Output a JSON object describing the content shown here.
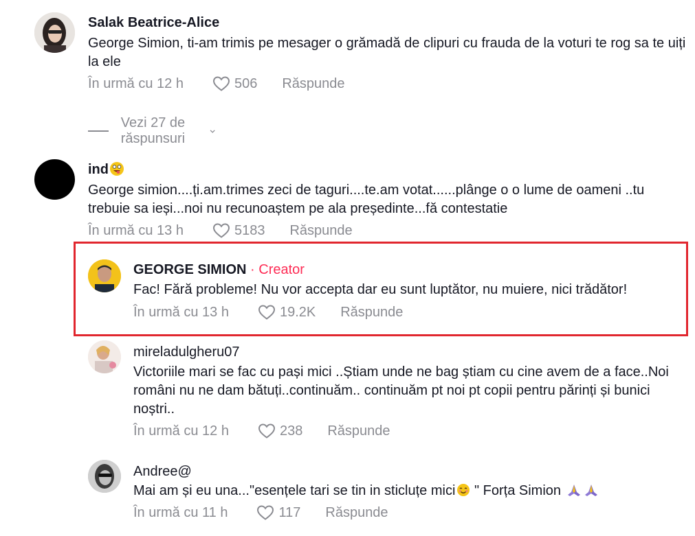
{
  "comments": [
    {
      "username": "Salak Beatrice-Alice",
      "text": "George Simion, ti-am trimis pe mesager o grămadă de clipuri cu frauda de la voturi te rog sa te uiți la ele",
      "time": "În urmă cu 12 h",
      "likes": "506",
      "reply": "Răspunde",
      "view_replies": "Vezi 27 de răspunsuri"
    },
    {
      "username": "ind",
      "text": "George simion....ți.am.trimes zeci de taguri....te.am votat......plânge o o lume de oameni ..tu trebuie sa ieși...noi nu recunoaștem pe ala președinte...fă contestatie",
      "time": "În urmă cu 13 h",
      "likes": "5183",
      "reply": "Răspunde"
    }
  ],
  "replies": [
    {
      "username": "GEORGE SIMION",
      "creator_label": "· Creator",
      "text": "Fac! Fără probleme! Nu vor accepta dar eu sunt luptător, nu muiere, nici trădător!",
      "time": "În urmă cu 13 h",
      "likes": "19.2K",
      "reply": "Răspunde"
    },
    {
      "username": "mireladulgheru07",
      "text": "Victoriile mari se fac cu pași mici ..Știam unde ne bag știam cu cine avem de a face..Noi români nu ne dam bătuți..continuăm.. continuăm pt noi pt copii pentru părinți și bunici noștri..",
      "time": "În urmă cu 12 h",
      "likes": "238",
      "reply": "Răspunde"
    },
    {
      "username": "Andree@",
      "text_a": "Mai am și eu una...\"esențele tari se tin in sticluțe mici",
      "text_b": " \" Forța Simion ",
      "time": "În urmă cu 11 h",
      "likes": "117",
      "reply": "Răspunde"
    }
  ],
  "icons": {
    "like": "heart-outline-icon",
    "expand": "chevron-down-icon"
  },
  "colors": {
    "highlight_border": "#e1262e",
    "creator": "#fe2c55",
    "meta_text": "#8a8b91"
  }
}
